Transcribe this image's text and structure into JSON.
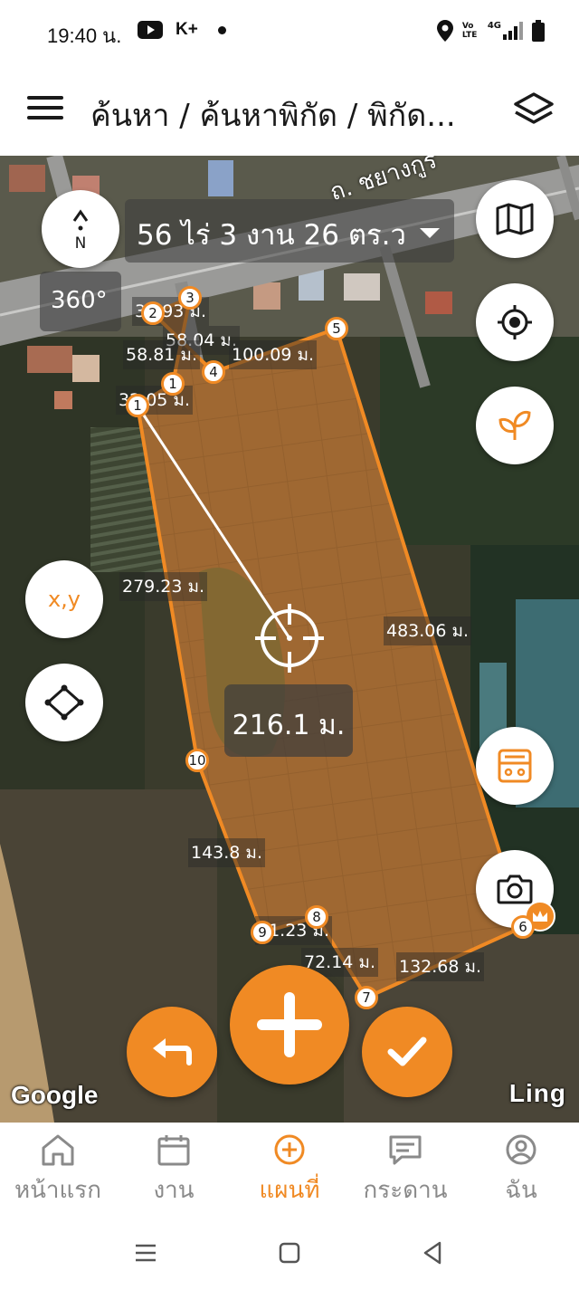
{
  "status_bar": {
    "time": "19:40 น.",
    "channel": "K+",
    "volte": "Vo LTE",
    "network": "4G"
  },
  "header": {
    "breadcrumb": "ค้นหา / ค้นหาพิกัด / พิกัด...",
    "menu_icon": "hamburger-menu-icon",
    "layers_icon": "layers-icon"
  },
  "map": {
    "compass_letter": "N",
    "area": "56 ไร่ 3 งาน 26 ตร.ว",
    "rotation": "360°",
    "road_name": "ถ. ชยางกูร",
    "distance": "216.1 ม.",
    "google": "Google",
    "ling": "Ling",
    "vertices": [
      "1",
      "2",
      "3",
      "4",
      "5",
      "6",
      "7",
      "8",
      "9",
      "10",
      "1"
    ],
    "segment_labels": {
      "s1": "32.93 ม.",
      "s2": "58.04 ม.",
      "s3": "58.81 ม.",
      "s4": "100.09 ม.",
      "s5": "32.05 ม.",
      "s6": "279.23 ม.",
      "s7": "483.06 ม.",
      "s8": "143.8 ม.",
      "s9": "41.23 ม.",
      "s10": "72.14 ม.",
      "s11": "132.68 ม."
    },
    "side_buttons": {
      "xy": "x,y"
    }
  },
  "bottom_nav": [
    {
      "label": "หน้าแรก",
      "icon": "home-icon",
      "active": false
    },
    {
      "label": "งาน",
      "icon": "calendar-icon",
      "active": false
    },
    {
      "label": "แผนที่",
      "icon": "add-circle-icon",
      "active": true
    },
    {
      "label": "กระดาน",
      "icon": "board-icon",
      "active": false
    },
    {
      "label": "ฉัน",
      "icon": "profile-icon",
      "active": false
    }
  ],
  "colors": {
    "accent": "#f08a24",
    "parcel_fill": "rgba(220,130,50,0.45)"
  }
}
